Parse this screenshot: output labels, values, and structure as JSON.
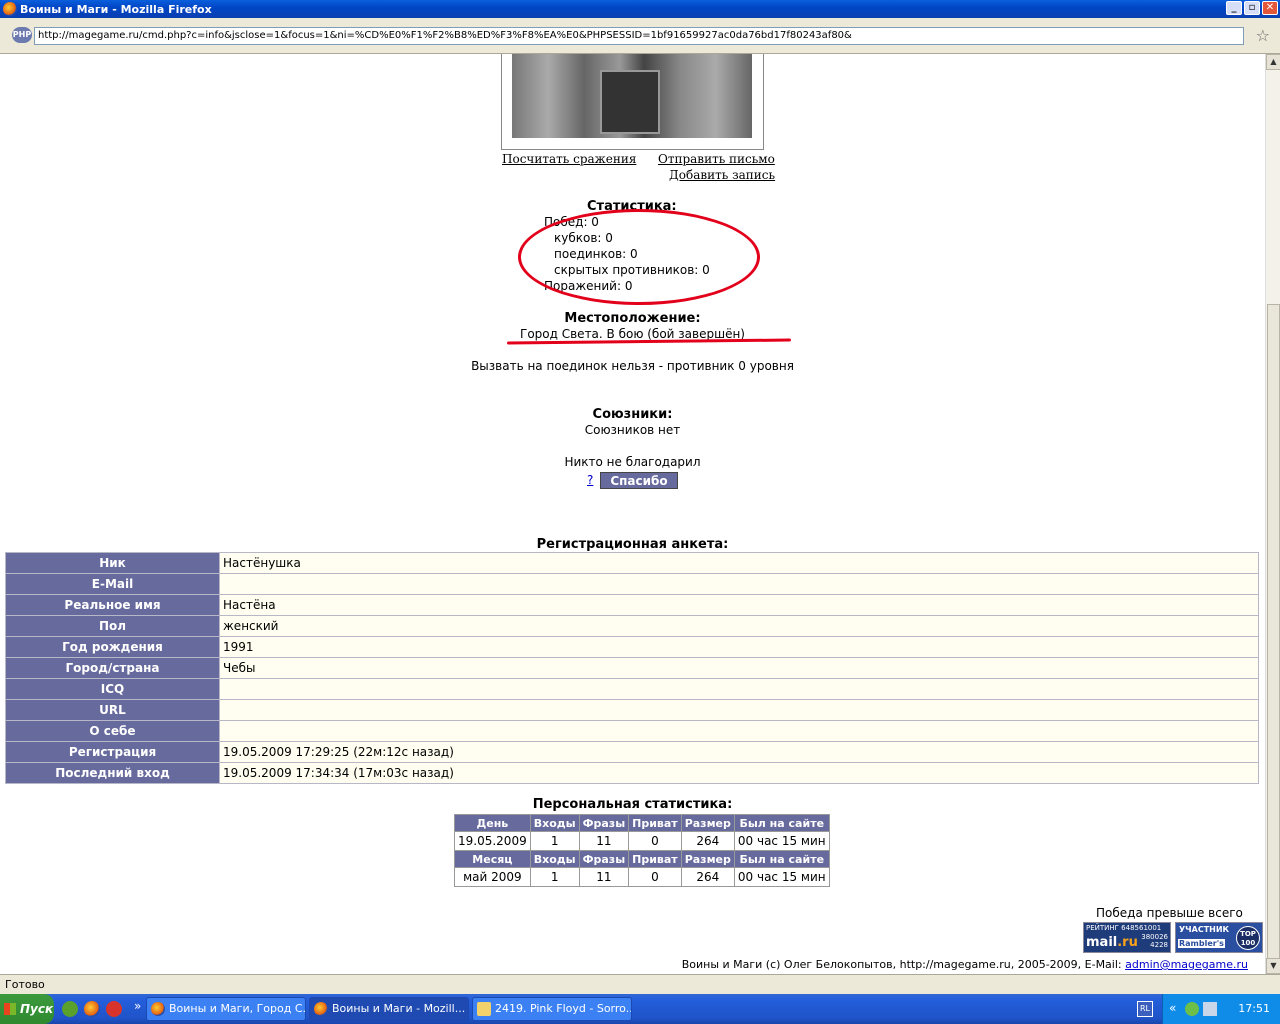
{
  "window": {
    "title": "Воины и Маги - Mozilla Firefox",
    "min": "_",
    "max": "▫",
    "close": "✕"
  },
  "browser": {
    "address_icon": "PHP",
    "url": "http://magegame.ru/cmd.php?c=info&jsclose=1&focus=1&ni=%CD%E0%F1%F2%B8%ED%F3%F8%EA%E0&PHPSESSID=1bf91659927ac0da76bd17f80243af80&",
    "status": "Готово"
  },
  "profile": {
    "links": {
      "count_battles": "Посчитать сражения",
      "send_letter": "Отправить письмо",
      "add_record": "Добавить запись"
    },
    "statistics_title": "Статистика:",
    "stats": [
      "Побед: 0",
      "кубков: 0",
      "поединков: 0",
      "скрытых противников: 0",
      "Поражений: 0"
    ],
    "location_title": "Местоположение:",
    "location_value": "Город Света. В бою (бой завершён)",
    "duel_note": "Вызвать на поединок нельзя - противник 0 уровня",
    "allies_title": "Союзники:",
    "allies_value": "Союзников нет",
    "thanks_note": "Никто не благодарил",
    "thanks_help": "?",
    "thanks_button": "Спасибо"
  },
  "registration": {
    "title": "Регистрационная анкета:",
    "rows": [
      {
        "key": "Ник",
        "value": "Настёнушка"
      },
      {
        "key": "E-Mail",
        "value": ""
      },
      {
        "key": "Реальное имя",
        "value": "Настёна"
      },
      {
        "key": "Пол",
        "value": "женский"
      },
      {
        "key": "Год рождения",
        "value": "1991"
      },
      {
        "key": "Город/страна",
        "value": "Чебы"
      },
      {
        "key": "ICQ",
        "value": ""
      },
      {
        "key": "URL",
        "value": ""
      },
      {
        "key": "О себе",
        "value": ""
      },
      {
        "key": "Регистрация",
        "value": "19.05.2009 17:29:25 (22м:12с назад)"
      },
      {
        "key": "Последний вход",
        "value": "19.05.2009 17:34:34 (17м:03с назад)"
      }
    ]
  },
  "personal_stats": {
    "title": "Персональная статистика:",
    "day_headers": [
      "День",
      "Входы",
      "Фразы",
      "Приват",
      "Размер",
      "Был на сайте"
    ],
    "day_row": [
      "19.05.2009",
      "1",
      "11",
      "0",
      "264",
      "00 час 15 мин"
    ],
    "month_headers": [
      "Месяц",
      "Входы",
      "Фразы",
      "Приват",
      "Размер",
      "Был на сайте"
    ],
    "month_row": [
      "май 2009",
      "1",
      "11",
      "0",
      "264",
      "00 час 15 мин"
    ]
  },
  "footer": {
    "motto": "Победа превыше всего",
    "mailru_badge": {
      "label": "РЕЙТИНГ",
      "id": "648561001",
      "brand_a": "mail",
      "brand_b": ".ru",
      "n1": "380026",
      "n2": "4228"
    },
    "rambler_badge": {
      "line1": "УЧАСТНИК",
      "line2": "Rambler's",
      "top_a": "TOP",
      "top_b": "100"
    },
    "copyright": "Воины и Маги (c) Олег Белокопытов, http://magegame.ru, 2005-2009, E-Mail: ",
    "email": "admin@magegame.ru"
  },
  "taskbar": {
    "start": "Пуск",
    "chevron": "»",
    "tasks": [
      {
        "label": "Воины и Маги, Город С...",
        "active": false
      },
      {
        "label": "Воины и Маги - Mozill...",
        "active": true
      },
      {
        "label": "2419. Pink Floyd - Sorro...",
        "active": false
      }
    ],
    "lang": "RL",
    "tray_chevron": "«",
    "clock": "17:51"
  }
}
